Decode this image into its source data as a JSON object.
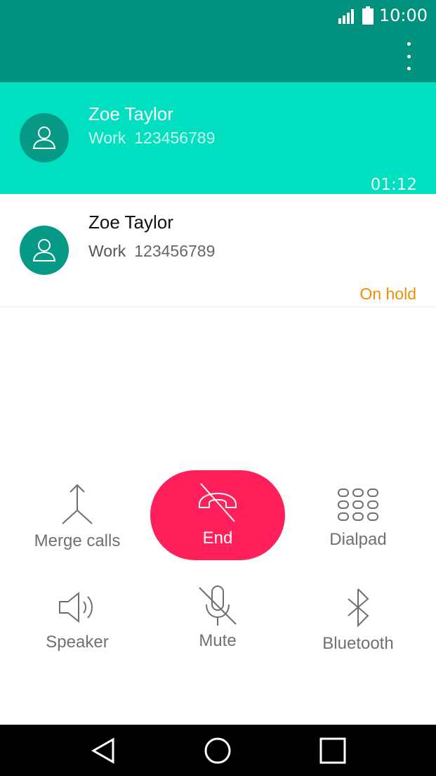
{
  "status_bar": {
    "time": "10:00"
  },
  "active_call": {
    "name": "Zoe Taylor",
    "label": "Work",
    "number": "123456789",
    "timer": "01:12"
  },
  "held_call": {
    "name": "Zoe Taylor",
    "label": "Work",
    "number": "123456789",
    "status": "On hold"
  },
  "controls": {
    "merge": "Merge calls",
    "end": "End",
    "dialpad": "Dialpad",
    "speaker": "Speaker",
    "mute": "Mute",
    "bluetooth": "Bluetooth"
  },
  "colors": {
    "header": "#00917f",
    "active": "#00dfc0",
    "end": "#ff1f5a",
    "hold": "#f28c00"
  }
}
